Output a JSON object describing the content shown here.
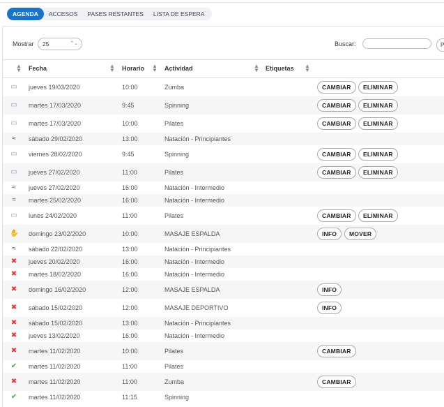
{
  "tabs": [
    "AGENDA",
    "ACCESOS",
    "PASES RESTANTES",
    "LISTA DE ESPERA"
  ],
  "controls": {
    "show_label": "Mostrar",
    "show_value": "25",
    "search_label": "Buscar:",
    "search_value": "",
    "cut_button": "P"
  },
  "columns": [
    "Fecha",
    "Horario",
    "Actividad",
    "Etiquetas"
  ],
  "rows": [
    {
      "icon": "ticket-icon",
      "fecha": "jueves 19/03/2020",
      "hora": "10:00",
      "actividad": "Zumba",
      "buttons": [
        "CAMBIAR",
        "ELIMINAR"
      ]
    },
    {
      "icon": "ticket-icon",
      "fecha": "martes 17/03/2020",
      "hora": "9:45",
      "actividad": "Spinning",
      "buttons": [
        "CAMBIAR",
        "ELIMINAR"
      ]
    },
    {
      "icon": "ticket-icon",
      "fecha": "martes 17/03/2020",
      "hora": "10:00",
      "actividad": "Pilates",
      "buttons": [
        "CAMBIAR",
        "ELIMINAR"
      ]
    },
    {
      "icon": "swimmer-icon",
      "fecha": "sábado 29/02/2020",
      "hora": "13:00",
      "actividad": "Natación - Principiantes",
      "buttons": []
    },
    {
      "icon": "ticket-icon",
      "fecha": "viernes 28/02/2020",
      "hora": "9:45",
      "actividad": "Spinning",
      "buttons": [
        "CAMBIAR",
        "ELIMINAR"
      ]
    },
    {
      "icon": "ticket-icon",
      "fecha": "jueves 27/02/2020",
      "hora": "11:00",
      "actividad": "Pilates",
      "buttons": [
        "CAMBIAR",
        "ELIMINAR"
      ]
    },
    {
      "icon": "swimmer-icon",
      "fecha": "jueves 27/02/2020",
      "hora": "16:00",
      "actividad": "Natación - Intermedio",
      "buttons": []
    },
    {
      "icon": "swimmer-icon",
      "fecha": "martes 25/02/2020",
      "hora": "16:00",
      "actividad": "Natación - Intermedio",
      "buttons": []
    },
    {
      "icon": "ticket-icon",
      "fecha": "lunes 24/02/2020",
      "hora": "11:00",
      "actividad": "Pilates",
      "buttons": [
        "CAMBIAR",
        "ELIMINAR"
      ]
    },
    {
      "icon": "massage-icon",
      "fecha": "domingo 23/02/2020",
      "hora": "10:00",
      "actividad": "MASAJE ESPALDA",
      "buttons": [
        "INFO",
        "MOVER"
      ]
    },
    {
      "icon": "swimmer-icon",
      "fecha": "sábado 22/02/2020",
      "hora": "13:00",
      "actividad": "Natación - Principiantes",
      "buttons": []
    },
    {
      "icon": "cancel-icon",
      "fecha": "jueves 20/02/2020",
      "hora": "16:00",
      "actividad": "Natación - Intermedio",
      "buttons": []
    },
    {
      "icon": "cancel-icon",
      "fecha": "martes 18/02/2020",
      "hora": "16:00",
      "actividad": "Natación - Intermedio",
      "buttons": []
    },
    {
      "icon": "cancel-icon",
      "fecha": "domingo 16/02/2020",
      "hora": "12:00",
      "actividad": "MASAJE ESPALDA",
      "buttons": [
        "INFO"
      ]
    },
    {
      "icon": "cancel-icon",
      "fecha": "sábado 15/02/2020",
      "hora": "12:00",
      "actividad": "MASAJE DEPORTIVO",
      "buttons": [
        "INFO"
      ]
    },
    {
      "icon": "cancel-icon",
      "fecha": "sábado 15/02/2020",
      "hora": "13:00",
      "actividad": "Natación - Principiantes",
      "buttons": []
    },
    {
      "icon": "cancel-icon",
      "fecha": "jueves 13/02/2020",
      "hora": "16:00",
      "actividad": "Natación - Intermedio",
      "buttons": []
    },
    {
      "icon": "cancel-icon",
      "fecha": "martes 11/02/2020",
      "hora": "10:00",
      "actividad": "Pilates",
      "buttons": [
        "CAMBIAR"
      ]
    },
    {
      "icon": "check-icon",
      "fecha": "martes 11/02/2020",
      "hora": "11:00",
      "actividad": "Pilates",
      "buttons": []
    },
    {
      "icon": "cancel-icon",
      "fecha": "martes 11/02/2020",
      "hora": "11:00",
      "actividad": "Zumba",
      "buttons": [
        "CAMBIAR"
      ]
    },
    {
      "icon": "check-icon",
      "fecha": "martes 11/02/2020",
      "hora": "11:15",
      "actividad": "Spinning",
      "buttons": []
    }
  ],
  "colors": {
    "accent": "#1a73c9",
    "cancel": "#e53935",
    "check": "#43a047"
  }
}
